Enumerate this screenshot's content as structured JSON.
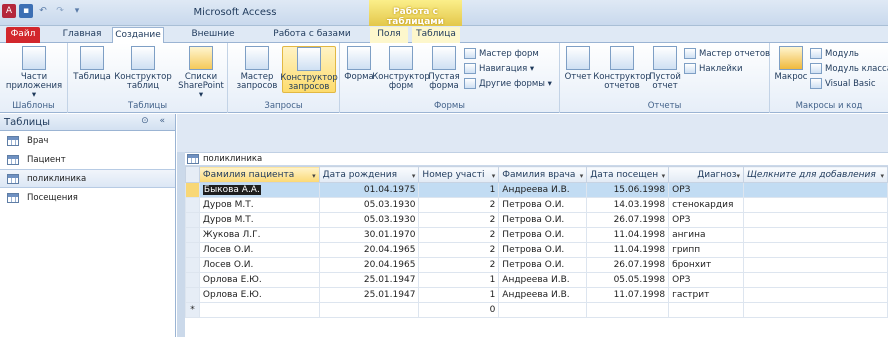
{
  "window": {
    "title": "Microsoft Access",
    "context_title": "Работа с таблицами"
  },
  "tabs": [
    {
      "label": "Файл"
    },
    {
      "label": "Главная"
    },
    {
      "label": "Создание"
    },
    {
      "label": "Внешние данные"
    },
    {
      "label": "Работа с базами данных"
    },
    {
      "label": "Поля"
    },
    {
      "label": "Таблица"
    }
  ],
  "ribbon": {
    "groups": {
      "templates": "Шаблоны",
      "tables": "Таблицы",
      "queries": "Запросы",
      "forms": "Формы",
      "reports": "Отчеты",
      "macros": "Макросы и код"
    },
    "buttons": {
      "app_parts": "Части приложения ▾",
      "table": "Таблица",
      "table_designer": "Конструктор таблиц",
      "sharepoint_lists": "Списки SharePoint ▾",
      "query_wizard": "Мастер запросов",
      "query_designer": "Конструктор запросов",
      "form": "Форма",
      "form_designer": "Конструктор форм",
      "blank_form": "Пустая форма",
      "form_wizard": "Мастер форм",
      "navigation": "Навигация ▾",
      "other_forms": "Другие формы ▾",
      "report": "Отчет",
      "report_designer": "Конструктор отчетов",
      "blank_report": "Пустой отчет",
      "report_wizard": "Мастер отчетов",
      "labels": "Наклейки",
      "macro": "Макрос",
      "module": "Модуль",
      "class_module": "Модуль класса",
      "visual_basic": "Visual Basic"
    }
  },
  "nav": {
    "header": "Таблицы",
    "controls": "⊙ «",
    "items": [
      "Врач",
      "Пациент",
      "поликлиника",
      "Посещения"
    ]
  },
  "document": {
    "tab_title": "поликлиника",
    "columns": [
      "Фамилия пациента",
      "Дата рождения",
      "Номер участі",
      "Фамилия врача",
      "Дата посещен",
      "Диагноз",
      "Щелкните для добавления"
    ],
    "rows": [
      [
        "Быкова А.А.",
        "01.04.1975",
        "1",
        "Андреева И.В.",
        "15.06.1998",
        "ОРЗ"
      ],
      [
        "Дуров М.Т.",
        "05.03.1930",
        "2",
        "Петрова О.И.",
        "14.03.1998",
        "стенокардия"
      ],
      [
        "Дуров М.Т.",
        "05.03.1930",
        "2",
        "Петрова О.И.",
        "26.07.1998",
        "ОРЗ"
      ],
      [
        "Жукова Л.Г.",
        "30.01.1970",
        "2",
        "Петрова О.И.",
        "11.04.1998",
        "ангина"
      ],
      [
        "Лосев О.И.",
        "20.04.1965",
        "2",
        "Петрова О.И.",
        "11.04.1998",
        "грипп"
      ],
      [
        "Лосев О.И.",
        "20.04.1965",
        "2",
        "Петрова О.И.",
        "26.07.1998",
        "бронхит"
      ],
      [
        "Орлова Е.Ю.",
        "25.01.1947",
        "1",
        "Андреева И.В.",
        "05.05.1998",
        "ОРЗ"
      ],
      [
        "Орлова Е.Ю.",
        "25.01.1947",
        "1",
        "Андреева И.В.",
        "11.07.1998",
        "гастрит"
      ]
    ],
    "new_row_marker": "*",
    "new_row_default": "0"
  },
  "colors": {
    "file_tab": "#d2272c",
    "selected_row": "#c2dcf3",
    "active_header": "#fbd873"
  }
}
